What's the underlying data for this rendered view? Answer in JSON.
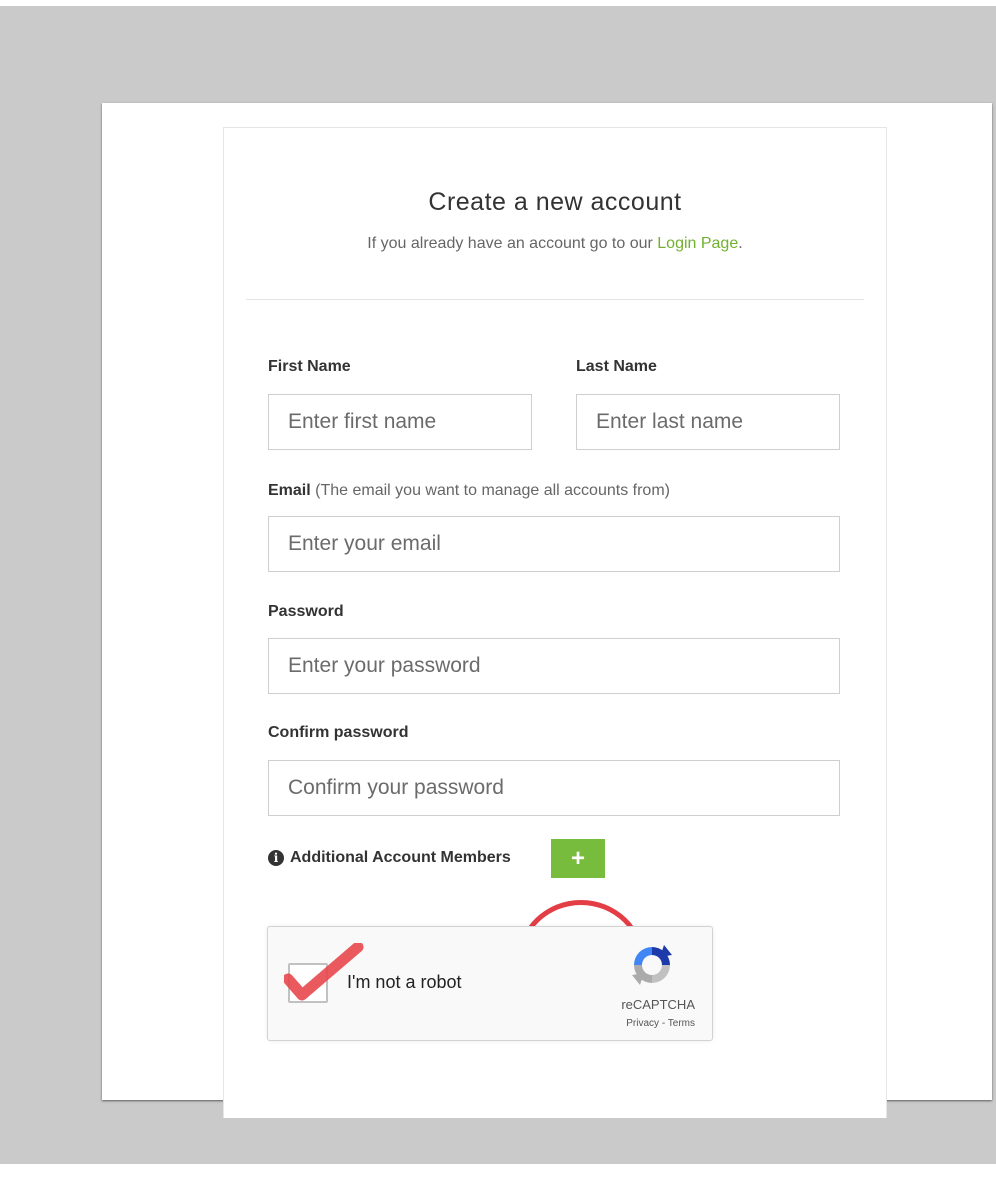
{
  "form": {
    "title": "Create a new account",
    "subtitle_prefix": "If you already have an account go to our ",
    "login_link": "Login Page",
    "subtitle_suffix": ".",
    "first_name": {
      "label": "First Name",
      "placeholder": "Enter first name",
      "value": ""
    },
    "last_name": {
      "label": "Last Name",
      "placeholder": "Enter last name",
      "value": ""
    },
    "email": {
      "label": "Email",
      "hint": "(The email you want to manage all accounts from)",
      "placeholder": "Enter your email",
      "value": ""
    },
    "password": {
      "label": "Password",
      "placeholder": "Enter your password",
      "value": ""
    },
    "confirm_password": {
      "label": "Confirm password",
      "placeholder": "Confirm your password",
      "value": ""
    },
    "members": {
      "info_glyph": "i",
      "label": "Additional Account Members",
      "add_label": "+"
    }
  },
  "captcha": {
    "label": "I'm not a robot",
    "checked": true,
    "brand": "reCAPTCHA",
    "privacy": "Privacy",
    "separator": " - ",
    "terms": "Terms"
  },
  "colors": {
    "accent": "#78bc3e",
    "link": "#72b12f",
    "annotation": "#e33d45",
    "backdrop": "#c9cac9"
  }
}
